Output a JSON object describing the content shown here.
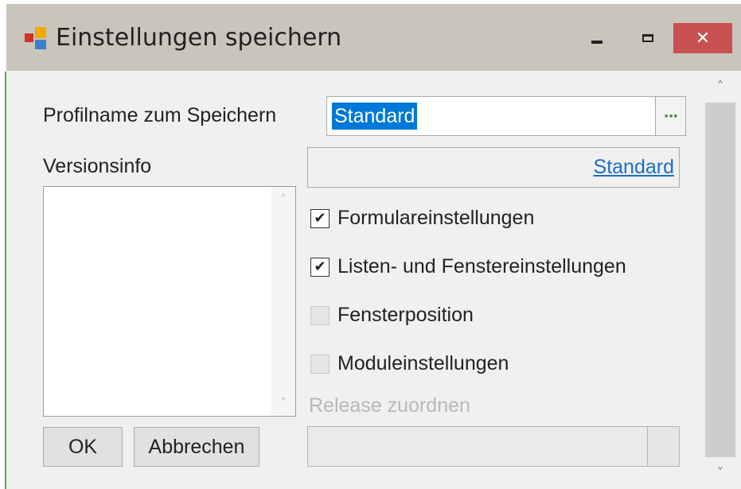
{
  "window": {
    "title": "Einstellungen speichern",
    "close_label": "✕"
  },
  "form": {
    "profile_label": "Profilname zum Speichern",
    "profile_value": "Standard",
    "browse_label": "···",
    "version_label": "Versionsinfo",
    "standard_link": "Standard",
    "checkboxes": [
      {
        "label": "Formulareinstellungen",
        "checked": true,
        "enabled": true
      },
      {
        "label": "Listen- und Fenstereinstellungen",
        "checked": true,
        "enabled": true
      },
      {
        "label": "Fensterposition",
        "checked": false,
        "enabled": false
      },
      {
        "label": "Moduleinstellungen",
        "checked": false,
        "enabled": false
      }
    ],
    "check_mark": "✔",
    "release_label": "Release zuordnen",
    "ok_label": "OK",
    "cancel_label": "Abbrechen"
  },
  "scroll": {
    "up_arrow": "˄",
    "down_arrow": "˅"
  },
  "colors": {
    "titlebar": "#c9c5bb",
    "close_button": "#c75050",
    "selection": "#0078d7",
    "link": "#1b6ec2",
    "browse_dots": "#3a8a2e"
  },
  "icons": {
    "app": "app-icon",
    "minimize": "minimize-icon",
    "maximize": "maximize-icon",
    "close": "close-icon"
  }
}
